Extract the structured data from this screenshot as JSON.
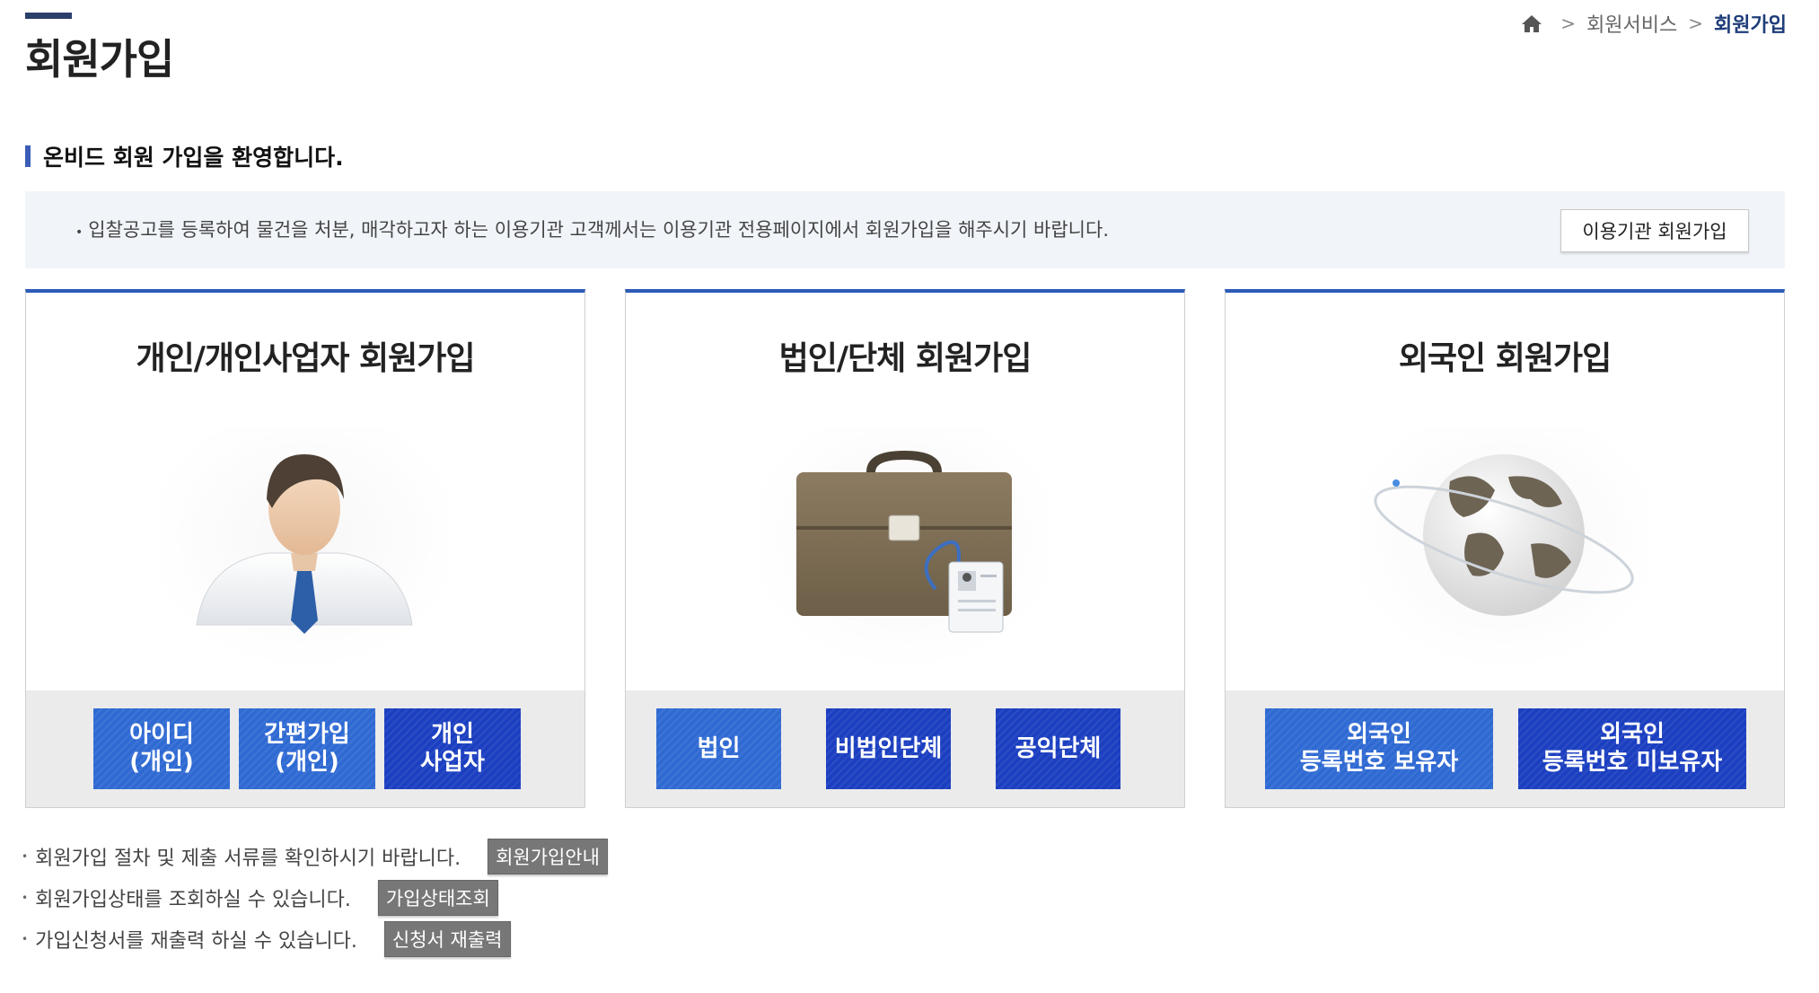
{
  "page": {
    "title": "회원가입"
  },
  "breadcrumb": {
    "home_icon": "home-icon",
    "separator": ">",
    "items": [
      "회원서비스",
      "회원가입"
    ]
  },
  "section": {
    "heading": "온비드 회원 가입을 환영합니다."
  },
  "notice": {
    "bullet": "•",
    "message": "입찰공고를 등록하여 물건을 처분, 매각하고자 하는 이용기관 고객께서는 이용기관 전용페이지에서 회원가입을 해주시기 바랍니다.",
    "button": "이용기관 회원가입"
  },
  "cards": [
    {
      "title": "개인/개인사업자 회원가입",
      "icon": "person-icon",
      "buttons": [
        "아이디\n(개인)",
        "간편가입\n(개인)",
        "개인\n사업자"
      ]
    },
    {
      "title": "법인/단체 회원가입",
      "icon": "briefcase-icon",
      "buttons": [
        "법인",
        "비법인단체",
        "공익단체"
      ]
    },
    {
      "title": "외국인 회원가입",
      "icon": "globe-icon",
      "buttons": [
        "외국인\n등록번호 보유자",
        "외국인\n등록번호 미보유자"
      ]
    }
  ],
  "info": [
    {
      "text": "회원가입 절차 및 제출 서류를 확인하시기 바랍니다.",
      "button": "회원가입안내"
    },
    {
      "text": "회원가입상태를 조회하실 수 있습니다.",
      "button": "가입상태조회"
    },
    {
      "text": "가입신청서를 재출력 하실 수 있습니다.",
      "button": "신청서 재출력"
    }
  ],
  "colors": {
    "accent": "#2c5ab7",
    "button_light": "#2f6ad3",
    "button_dark": "#1b3fc0",
    "title_bar": "#2b3f6b"
  }
}
